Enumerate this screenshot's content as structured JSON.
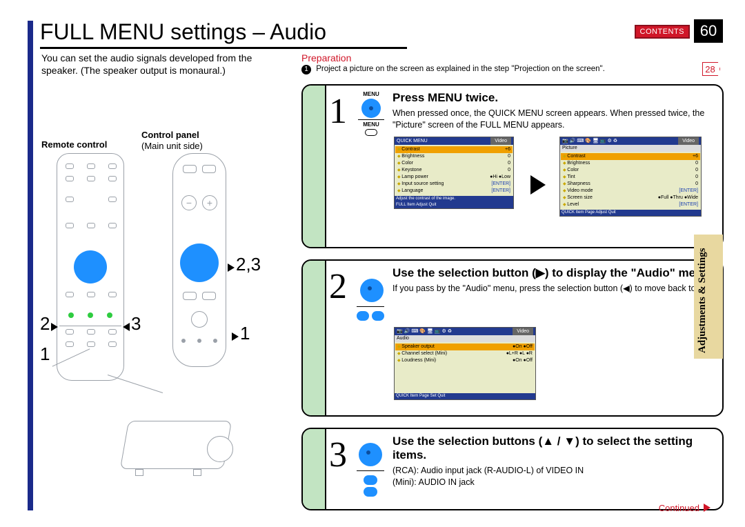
{
  "page": {
    "title": "FULL MENU settings – Audio",
    "number": "60",
    "contents_label": "CONTENTS",
    "section_tab": "Adjustments & Settings",
    "continued": "Continued"
  },
  "intro": "You can set the audio signals developed from the speaker. (The speaker output is monaural.)",
  "labels": {
    "remote": "Remote control",
    "panel": "Control panel",
    "panel_sub": "(Main unit side)"
  },
  "callouts": {
    "a": "2,3",
    "b": "2",
    "c": "3",
    "d": "1",
    "e": "1"
  },
  "prep": {
    "heading": "Preparation",
    "bullet_num": "1",
    "text": "Project a picture on the screen as explained in the step \"Projection on the screen\".",
    "ref": "28"
  },
  "steps": {
    "s1": {
      "num": "1",
      "menu_label": "MENU",
      "title": "Press MENU twice.",
      "body": "When pressed once, the QUICK MENU screen appears. When pressed twice, the \"Picture\" screen of the FULL MENU appears."
    },
    "s2": {
      "num": "2",
      "title": "Use the selection button (▶) to display the \"Audio\" menu.",
      "body": "If you pass by the \"Audio\" menu, press the selection button (◀) to move back to it."
    },
    "s3": {
      "num": "3",
      "title": "Use the selection buttons (▲ / ▼) to select the setting items.",
      "body1": "(RCA): Audio input jack (R-AUDIO-L) of VIDEO IN",
      "body2": "(Mini): AUDIO IN jack"
    }
  },
  "osd": {
    "quick": {
      "title_l": "QUICK MENU",
      "title_r": "Video",
      "rows": [
        [
          "Contrast",
          "+6"
        ],
        [
          "Brightness",
          "0"
        ],
        [
          "Color",
          "0"
        ],
        [
          "Keystone",
          "0"
        ],
        [
          "Lamp power",
          "●Hi   ●Low"
        ],
        [
          "Input source setting",
          "[ENTER]"
        ],
        [
          "Language",
          "[ENTER]"
        ]
      ],
      "msg": "Adjust the contrast of the image.",
      "foot": "FULL   Item   Adjust            Quit"
    },
    "picture": {
      "title_l": "Picture",
      "title_r": "Video",
      "rows": [
        [
          "Contrast",
          "+6"
        ],
        [
          "Brightness",
          "0"
        ],
        [
          "Color",
          "0"
        ],
        [
          "Tint",
          "0"
        ],
        [
          "Sharpness",
          "0"
        ],
        [
          "Video mode",
          "[ENTER]"
        ],
        [
          "Screen size",
          "●Full ●Thru ●Wide"
        ],
        [
          "Level",
          "[ENTER]"
        ]
      ],
      "foot": "QUICK   Item   Page   Adjust   Quit"
    },
    "audio": {
      "title_l": "Audio",
      "title_r": "Video",
      "rows": [
        [
          "Speaker output",
          "●On   ●Off"
        ],
        [
          "Channel select (Mini)",
          "●L+R ●L  ●R"
        ],
        [
          "Loudness (Mini)",
          "●On   ●Off"
        ]
      ],
      "foot": "QUICK   Item   Page   Set      Quit"
    }
  }
}
